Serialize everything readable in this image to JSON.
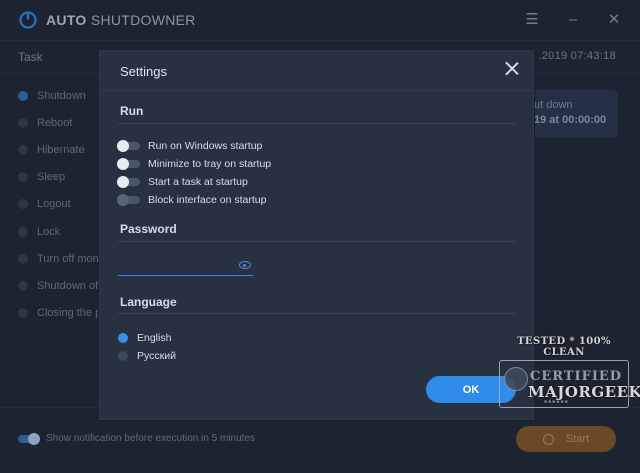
{
  "app": {
    "title_bold": "AUTO",
    "title_rest": "SHUTDOWNER",
    "menu_icon": "hamburger-icon",
    "minimize_icon": "minimize-icon",
    "close_icon": "close-icon"
  },
  "header": {
    "task_label": "Task",
    "datetime": ".2019   07:43:18"
  },
  "tasks": [
    {
      "label": "Shutdown",
      "selected": true
    },
    {
      "label": "Reboot",
      "selected": false
    },
    {
      "label": "Hibernate",
      "selected": false
    },
    {
      "label": "Sleep",
      "selected": false
    },
    {
      "label": "Logout",
      "selected": false
    },
    {
      "label": "Lock",
      "selected": false
    },
    {
      "label": "Turn off moni",
      "selected": false
    },
    {
      "label": "Shutdown of r",
      "selected": false
    },
    {
      "label": "Closing the pro",
      "selected": false
    }
  ],
  "info_card": {
    "line1": "ut down",
    "line2": "19 at 00:00:00"
  },
  "footer": {
    "notify_text": "Show notification before execution in 5 minutes",
    "notify_enabled": true,
    "start_label": "Start"
  },
  "settings": {
    "title": "Settings",
    "run_section": "Run",
    "run_options": [
      {
        "label": "Run on Windows startup",
        "enabled": true
      },
      {
        "label": "Minimize to tray on startup",
        "enabled": true
      },
      {
        "label": "Start a task at startup",
        "enabled": true
      },
      {
        "label": "Block interface on startup",
        "enabled": false
      }
    ],
    "password_section": "Password",
    "password_value": "",
    "language_section": "Language",
    "languages": [
      {
        "label": "English",
        "selected": true
      },
      {
        "label": "Русский",
        "selected": false
      }
    ],
    "ok_label": "OK"
  },
  "watermark": {
    "top": "TESTED * 100% CLEAN",
    "certified": "CERTIFIED",
    "name": "MAJORGEEKS",
    "stars": "******"
  },
  "colors": {
    "accent": "#2f8ce8",
    "modal_bg": "#273142",
    "app_bg": "#1d2431",
    "start_bg": "#6a4a26"
  }
}
